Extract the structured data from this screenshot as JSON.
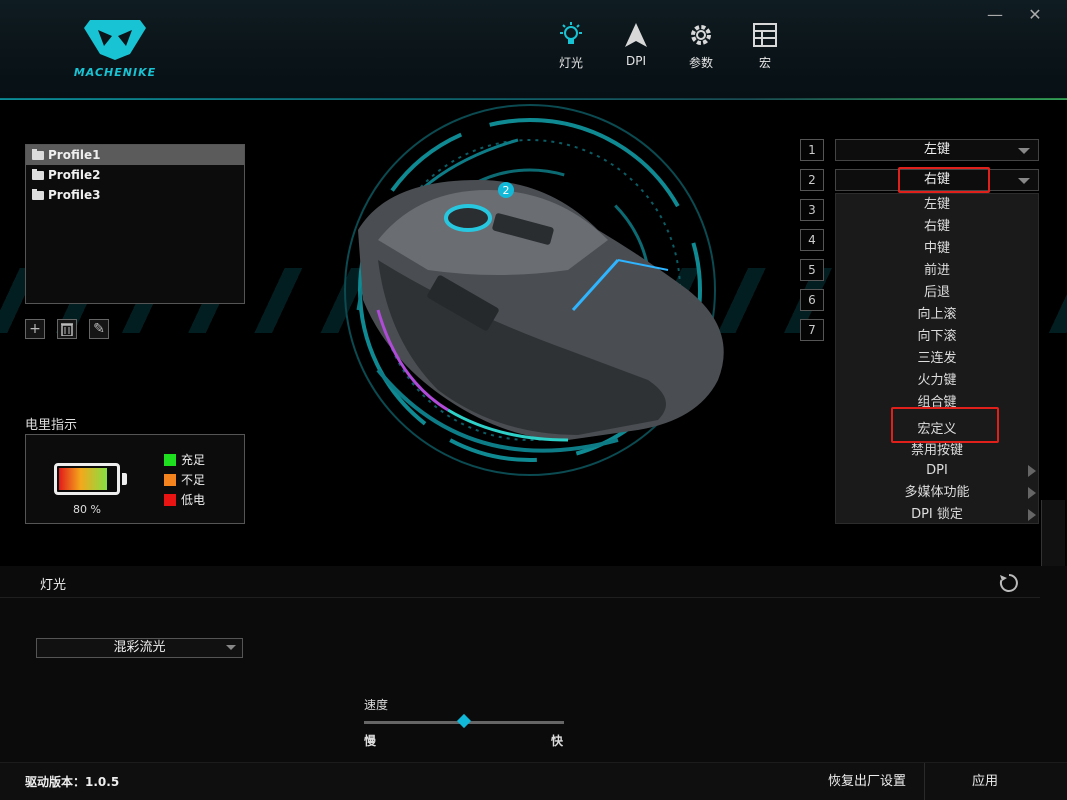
{
  "brand": {
    "logo_text": "MACHENIKE"
  },
  "nav": [
    {
      "label": "灯光",
      "icon": "bulb-icon"
    },
    {
      "label": "DPI",
      "icon": "arrow-up-icon"
    },
    {
      "label": "参数",
      "icon": "gear-icon"
    },
    {
      "label": "宏",
      "icon": "grid-icon"
    }
  ],
  "window": {
    "minimize": "—",
    "close": "✕"
  },
  "profiles": [
    {
      "label": "Profile1",
      "selected": true
    },
    {
      "label": "Profile2",
      "selected": false
    },
    {
      "label": "Profile3",
      "selected": false
    }
  ],
  "profile_tools": {
    "add": "+",
    "delete": "🗑",
    "edit": "✎"
  },
  "battery": {
    "title": "电里指示",
    "percent_text": "80 %",
    "level": 0.8,
    "legend": [
      {
        "label": "充足",
        "color": "#1ee01e"
      },
      {
        "label": "不足",
        "color": "#f5841f"
      },
      {
        "label": "低电",
        "color": "#e81414"
      }
    ]
  },
  "mouse_marker": "2",
  "buttons": {
    "slots": [
      "1",
      "2",
      "3",
      "4",
      "5",
      "6",
      "7"
    ],
    "slot1_value": "左键",
    "slot2_value": "右键",
    "dropdown_options": [
      "左键",
      "右键",
      "中键",
      "前进",
      "后退",
      "向上滚",
      "向下滚",
      "三连发",
      "火力键",
      "组合键",
      "宏定义",
      "禁用按键",
      "DPI",
      "多媒体功能",
      "DPI 锁定"
    ]
  },
  "lighting": {
    "title": "灯光",
    "mode": "混彩流光",
    "speed_label": "速度",
    "speed_slow": "慢",
    "speed_fast": "快",
    "speed_level": 0.5
  },
  "footer": {
    "driver_version": "驱动版本：1.0.5",
    "reset_factory": "恢复出厂设置",
    "apply": "应用"
  },
  "colors": {
    "accent": "#12b8d8",
    "highlight": "#e0201a"
  }
}
